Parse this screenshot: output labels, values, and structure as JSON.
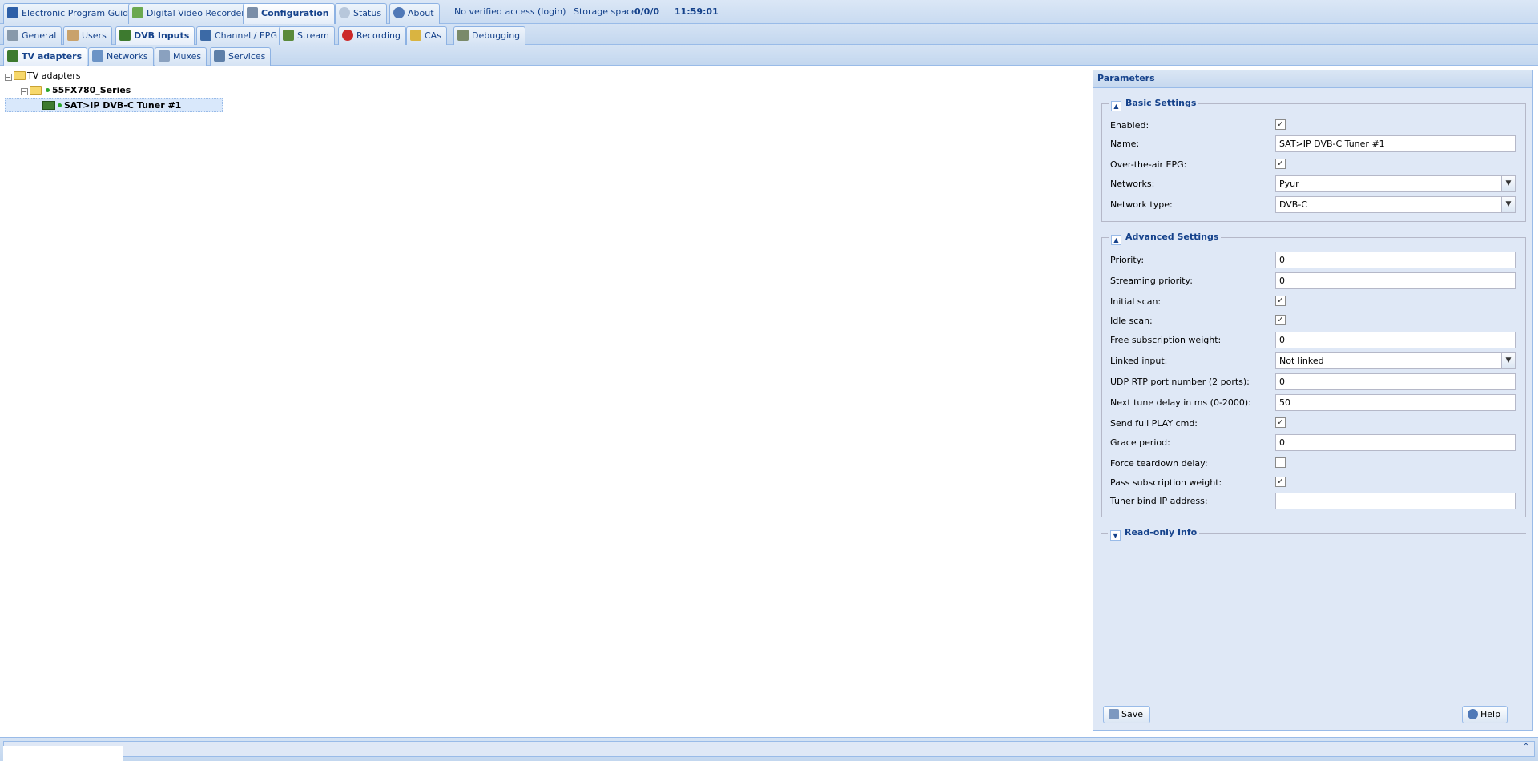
{
  "top_tabs": [
    {
      "label": "Electronic Program Guide",
      "icon": "epg-icon",
      "active": false
    },
    {
      "label": "Digital Video Recorder",
      "icon": "download-icon",
      "active": false
    },
    {
      "label": "Configuration",
      "icon": "wrench-icon",
      "active": true
    },
    {
      "label": "Status",
      "icon": "eye-icon",
      "active": false
    },
    {
      "label": "About",
      "icon": "info-icon",
      "active": false
    }
  ],
  "status_bar": {
    "access": "No verified access",
    "login": "(login)",
    "storage_label": "Storage space:",
    "storage_value": "0/0/0",
    "time": "11:59:01"
  },
  "config_tabs": [
    {
      "label": "General",
      "icon": "tools-icon"
    },
    {
      "label": "Users",
      "icon": "users-icon"
    },
    {
      "label": "DVB Inputs",
      "icon": "tv-card-icon",
      "active": true
    },
    {
      "label": "Channel / EPG",
      "icon": "tv-icon"
    },
    {
      "label": "Stream",
      "icon": "stream-icon"
    },
    {
      "label": "Recording",
      "icon": "rec-icon"
    },
    {
      "label": "CAs",
      "icon": "key-icon"
    },
    {
      "label": "Debugging",
      "icon": "bug-icon"
    }
  ],
  "dvb_tabs": [
    {
      "label": "TV adapters",
      "icon": "tv-card-icon",
      "active": true
    },
    {
      "label": "Networks",
      "icon": "antenna-icon"
    },
    {
      "label": "Muxes",
      "icon": "muxes-icon"
    },
    {
      "label": "Services",
      "icon": "services-icon"
    }
  ],
  "tree": {
    "root": "TV adapters",
    "device": "55FX780_Series",
    "tuner": "SAT>IP DVB-C Tuner #1"
  },
  "params": {
    "title": "Parameters",
    "basic": {
      "legend": "Basic Settings",
      "enabled_label": "Enabled:",
      "name_label": "Name:",
      "name_value": "SAT>IP DVB-C Tuner #1",
      "ota_epg_label": "Over-the-air EPG:",
      "networks_label": "Networks:",
      "networks_value": "Pyur",
      "network_type_label": "Network type:",
      "network_type_value": "DVB-C"
    },
    "advanced": {
      "legend": "Advanced Settings",
      "priority_label": "Priority:",
      "priority_value": "0",
      "streaming_priority_label": "Streaming priority:",
      "streaming_priority_value": "0",
      "initial_scan_label": "Initial scan:",
      "idle_scan_label": "Idle scan:",
      "free_sub_label": "Free subscription weight:",
      "free_sub_value": "0",
      "linked_input_label": "Linked input:",
      "linked_input_value": "Not linked",
      "udp_label": "UDP RTP port number (2 ports):",
      "udp_value": "0",
      "next_tune_label": "Next tune delay in ms (0-2000):",
      "next_tune_value": "50",
      "send_play_label": "Send full PLAY cmd:",
      "grace_label": "Grace period:",
      "grace_value": "0",
      "force_teardown_label": "Force teardown delay:",
      "pass_sub_label": "Pass subscription weight:",
      "tuner_bind_label": "Tuner bind IP address:",
      "tuner_bind_value": ""
    },
    "readonly": {
      "legend": "Read-only Info"
    },
    "save_label": "Save",
    "help_label": "Help"
  },
  "checkbox_mark": "✓",
  "colors": {
    "accent": "#15428b",
    "panel": "#dfe8f6",
    "border": "#99bbe8"
  }
}
